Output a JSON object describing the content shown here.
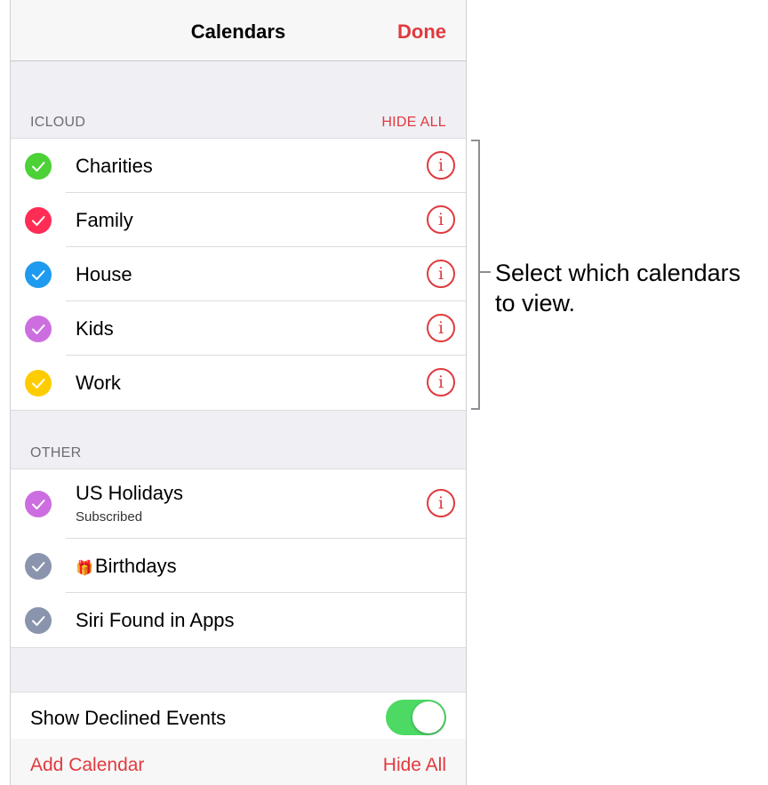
{
  "navbar": {
    "title": "Calendars",
    "done_label": "Done"
  },
  "icloud": {
    "header": "ICLOUD",
    "action": "HIDE ALL",
    "items": [
      {
        "label": "Charities",
        "color": "#4cd137",
        "info": "i"
      },
      {
        "label": "Family",
        "color": "#ff2d55",
        "info": "i"
      },
      {
        "label": "House",
        "color": "#1e9bf0",
        "info": "i"
      },
      {
        "label": "Kids",
        "color": "#cc6ee0",
        "info": "i"
      },
      {
        "label": "Work",
        "color": "#ffcc00",
        "info": "i"
      }
    ]
  },
  "other": {
    "header": "OTHER",
    "items": [
      {
        "label": "US Holidays",
        "sublabel": "Subscribed",
        "color": "#cc6ee0",
        "info": "i"
      },
      {
        "label": "Birthdays",
        "icon": "gift-icon",
        "icon_glyph": "🎁",
        "color": "#8a94ad"
      },
      {
        "label": "Siri Found in Apps",
        "color": "#8a94ad"
      }
    ]
  },
  "settings": {
    "show_declined_label": "Show Declined Events",
    "show_declined_on": true
  },
  "footer": {
    "add_calendar_label": "Add Calendar",
    "hide_all_label": "Hide All"
  },
  "callout": {
    "text": "Select which calendars to view."
  },
  "colors": {
    "accent": "#e03a3e",
    "toggle_on": "#4cd964"
  }
}
